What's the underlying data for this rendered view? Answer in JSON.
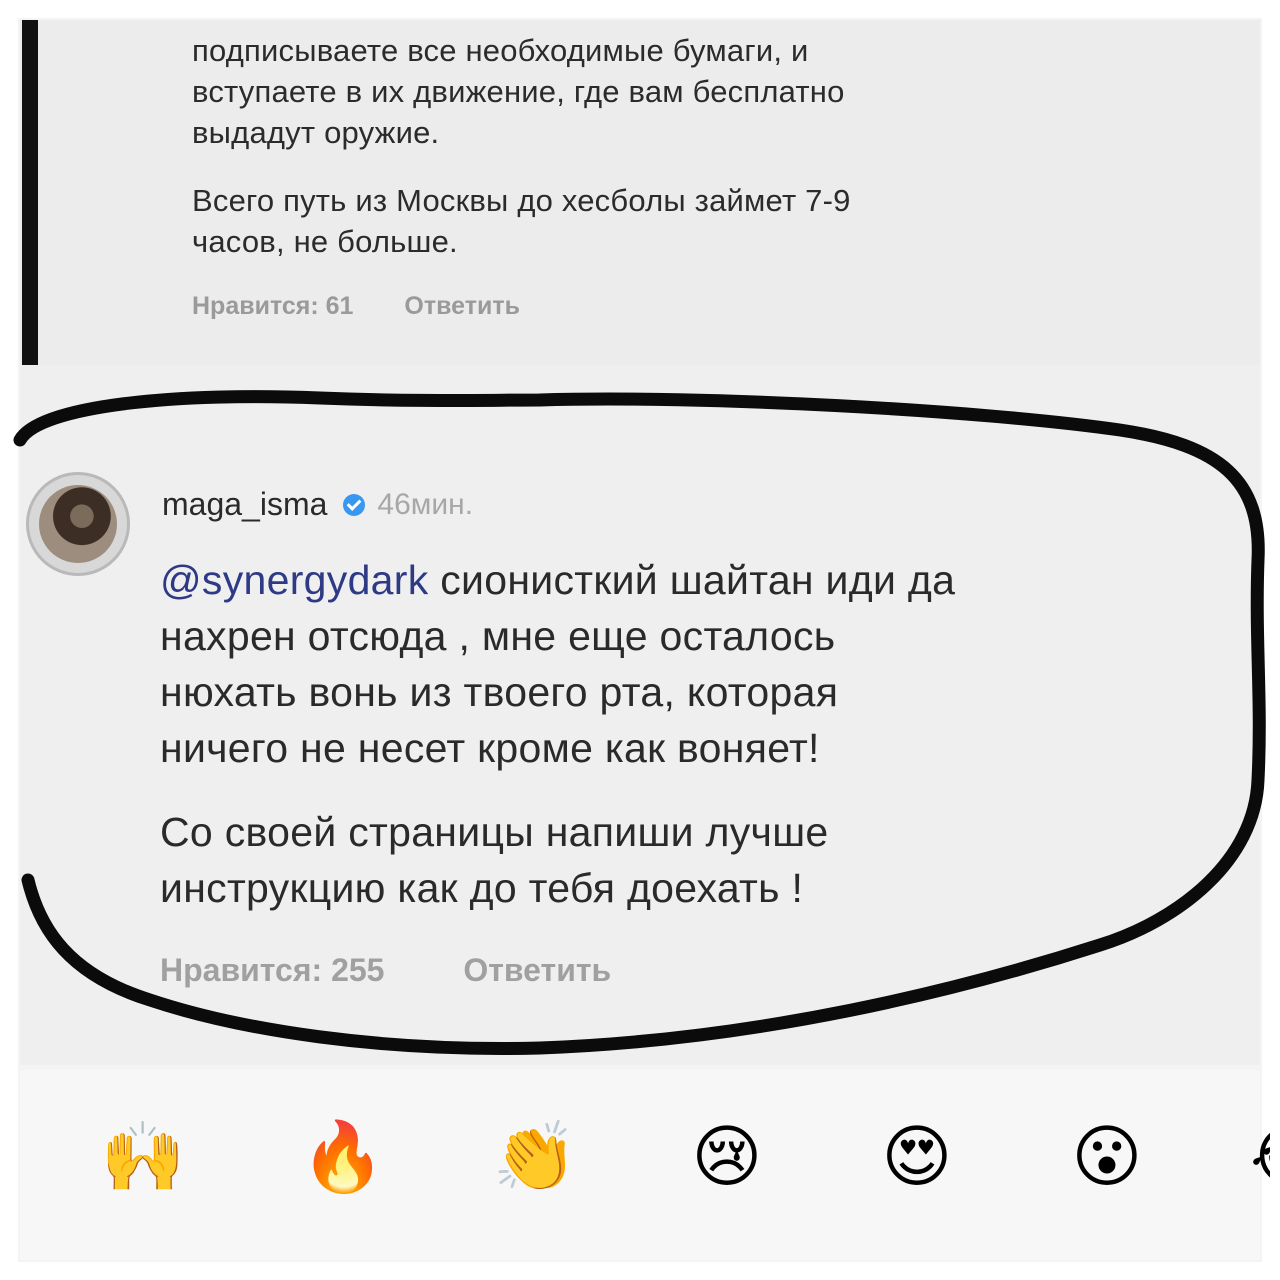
{
  "previous_comment": {
    "lines": [
      "подписываете все необходимые бумаги, и",
      "вступаете в их движение, где вам бесплатно",
      "выдадут оружие."
    ],
    "lines2": [
      "Всего путь из Москвы до хесболы займет 7-9",
      "часов, не больше."
    ],
    "likes_label": "Нравится: 61",
    "reply_label": "Ответить"
  },
  "reply_comment": {
    "username": "maga_isma",
    "time": "46мин.",
    "mention": "@synergydark",
    "text_first_line_rest": " сионисткий шайтан иди да",
    "paragraph1_lines": [
      "нахрен отсюда , мне еще осталось",
      "нюхать вонь из твоего рта, которая",
      "ничего не несет кроме как воняет!"
    ],
    "paragraph2_lines": [
      "Со своей страницы напиши лучше",
      "инструкцию как до тебя доехать !"
    ],
    "likes_label": "Нравится: 255",
    "reply_label": "Ответить"
  },
  "emoji_bar": {
    "emojis": [
      "🙌",
      "🔥",
      "👏",
      "😢",
      "😍",
      "😮",
      "😂"
    ]
  },
  "annotation": {
    "stroke_color": "#0b0b0b"
  }
}
